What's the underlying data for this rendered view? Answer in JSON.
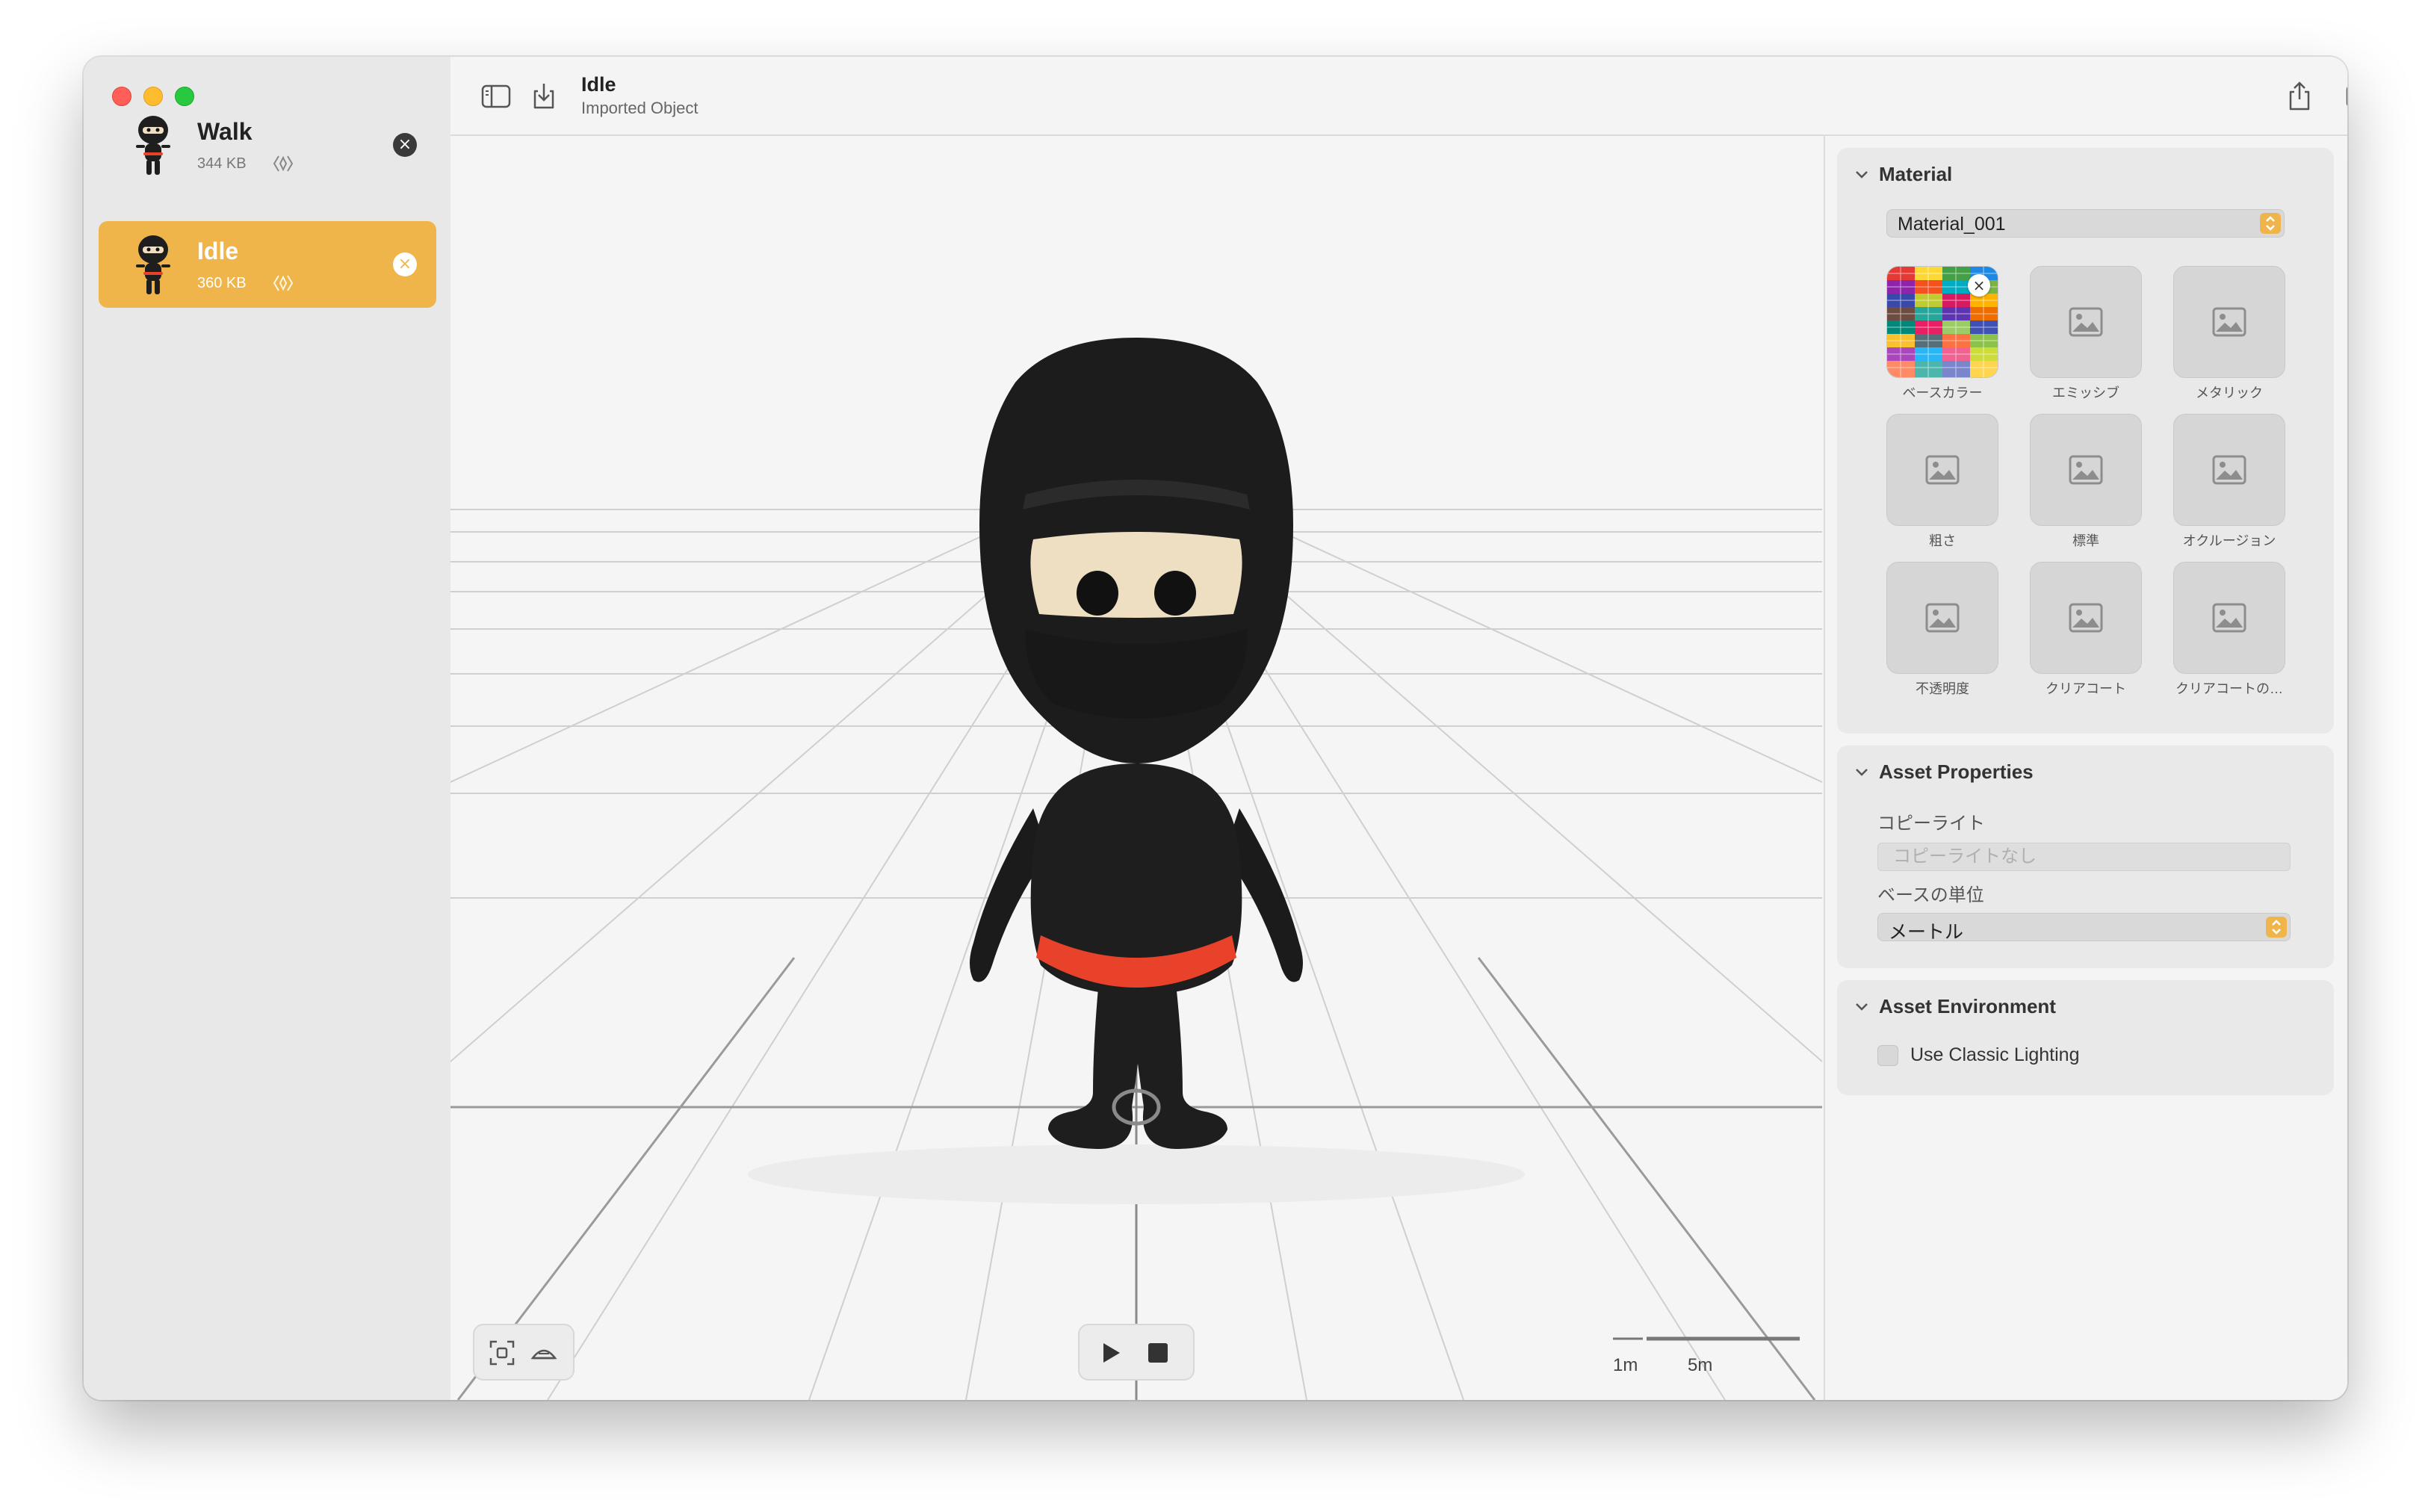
{
  "window": {
    "traffic_lights": [
      "close",
      "minimize",
      "zoom"
    ]
  },
  "sidebar": {
    "items": [
      {
        "name": "Walk",
        "size": "344 KB",
        "selected": false
      },
      {
        "name": "Idle",
        "size": "360 KB",
        "selected": true
      }
    ]
  },
  "toolbar": {
    "title": "Idle",
    "subtitle": "Imported Object"
  },
  "viewport": {
    "scale_labels": [
      "1m",
      "5m"
    ],
    "buttons": [
      "frame-icon",
      "ground-icon",
      "play-icon",
      "stop-icon"
    ]
  },
  "inspector": {
    "material": {
      "title": "Material",
      "selected": "Material_001",
      "textures": [
        {
          "label": "ベースカラー",
          "has_texture": true
        },
        {
          "label": "エミッシブ",
          "has_texture": false
        },
        {
          "label": "メタリック",
          "has_texture": false
        },
        {
          "label": "粗さ",
          "has_texture": false
        },
        {
          "label": "標準",
          "has_texture": false
        },
        {
          "label": "オクルージョン",
          "has_texture": false
        },
        {
          "label": "不透明度",
          "has_texture": false
        },
        {
          "label": "クリアコート",
          "has_texture": false
        },
        {
          "label": "クリアコートの…",
          "has_texture": false
        }
      ]
    },
    "asset_properties": {
      "title": "Asset Properties",
      "copyright_label": "コピーライト",
      "copyright_placeholder": "コピーライトなし",
      "unit_label": "ベースの単位",
      "unit_value": "メートル"
    },
    "asset_environment": {
      "title": "Asset Environment",
      "classic_lighting_label": "Use Classic Lighting",
      "classic_lighting_checked": false
    }
  },
  "colors": {
    "accent": "#efb54a",
    "belt": "#e8432a",
    "character": "#1e1e1e",
    "face": "#eedfc3"
  }
}
